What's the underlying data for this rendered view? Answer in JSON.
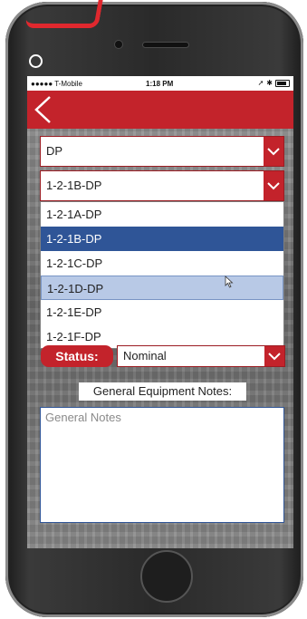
{
  "status_bar": {
    "carrier": "●●●●● T-Mobile",
    "time": "1:18 PM"
  },
  "header": {
    "color": "#c3232b",
    "back_icon": "chevron-left-icon"
  },
  "form": {
    "category_select": {
      "value": "DP"
    },
    "equipment_select": {
      "value": "1-2-1B-DP",
      "options": [
        "1-2-1A-DP",
        "1-2-1B-DP",
        "1-2-1C-DP",
        "1-2-1D-DP",
        "1-2-1E-DP",
        "1-2-1F-DP"
      ],
      "selected_option": "1-2-1B-DP",
      "hovered_option": "1-2-1D-DP"
    },
    "status": {
      "label": "Status:",
      "value": "Nominal"
    },
    "notes": {
      "label": "General Equipment Notes:",
      "placeholder": "General Notes"
    }
  },
  "colors": {
    "accent": "#c3232b",
    "selected": "#2f5597",
    "hover": "#b8c9e6"
  }
}
